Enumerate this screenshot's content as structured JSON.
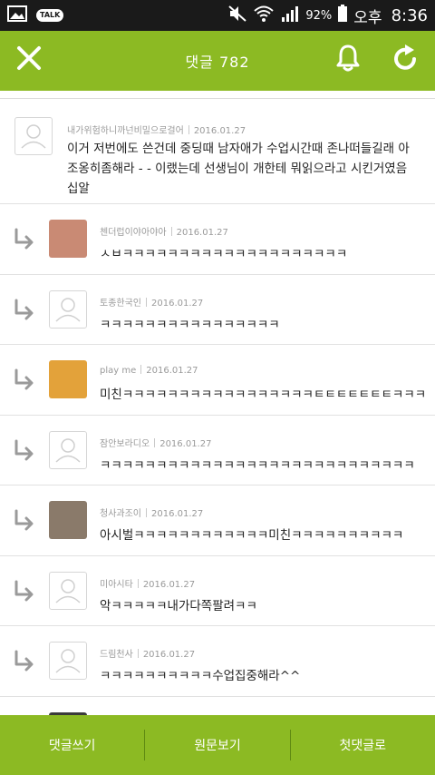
{
  "status_bar": {
    "battery_percent": "92%",
    "ampm": "오후",
    "time": "8:36",
    "talk_badge": "TALK"
  },
  "header": {
    "title": "댓글 782",
    "icons": [
      "close-icon",
      "bell-icon",
      "refresh-icon"
    ]
  },
  "comments": [
    {
      "author": "내가위험하니까넌비밀으로걸어",
      "date": "2016.01.27",
      "text": "이거 저번에도 쓴건데 중딩때 남자애가 수업시간때 존나떠들길래 아조옹히좀해라 - - 이랬는데 선생님이 개한테 뭐읽으라고 시킨거였음 십알"
    }
  ],
  "replies": [
    {
      "author": "첸더럽이야아야아",
      "date": "2016.01.27",
      "text": "ㅅㅂㅋㅋㅋㅋㅋㅋㅋㅋㅋㅋㅋㅋㅋㅋㅋㅋㅋㅋㅋㅋ",
      "avatar": "photo",
      "avatar_color": "#c98a74"
    },
    {
      "author": "토종한국인",
      "date": "2016.01.27",
      "text": "ㅋㅋㅋㅋㅋㅋㅋㅋㅋㅋㅋㅋㅋㅋㅋㅋ",
      "avatar": "default",
      "avatar_color": "#ffffff"
    },
    {
      "author": "play me",
      "date": "2016.01.27",
      "text": "미친ㅋㅋㅋㅋㅋㅋㅋㅋㅋㅋㅋㅋㅋㅋㅋㅋㅋㅌㅌㅌㅌㅌㅌㅌㅋㅋㅋㅋ",
      "avatar": "photo",
      "avatar_color": "#e3a23a"
    },
    {
      "author": "잠안보라디오",
      "date": "2016.01.27",
      "text": "ㅋㅋㅋㅋㅋㅋㅋㅋㅋㅋㅋㅋㅋㅋㅋㅋㅋㅋㅋㅋㅋㅋㅋㅋㅋㅋㅋㅋ",
      "avatar": "default",
      "avatar_color": "#ffffff"
    },
    {
      "author": "청사과조이",
      "date": "2016.01.27",
      "text": "아시벌ㅋㅋㅋㅋㅋㅋㅋㅋㅋㅋㅋㅋ미친ㅋㅋㅋㅋㅋㅋㅋㅋㅋㅋ",
      "avatar": "photo",
      "avatar_color": "#8a7a6a"
    },
    {
      "author": "미아시타",
      "date": "2016.01.27",
      "text": "악ㅋㅋㅋㅋㅋ내가다쪽팔려ㅋㅋ",
      "avatar": "default",
      "avatar_color": "#ffffff"
    },
    {
      "author": "드림천사",
      "date": "2016.01.27",
      "text": "ㅋㅋㅋㅋㅋㅋㅋㅋㅋㅋ수업집중해라^^",
      "avatar": "default",
      "avatar_color": "#ffffff"
    },
    {
      "author": "",
      "date": "",
      "text": "",
      "avatar": "photo",
      "avatar_color": "#3a3a3a"
    }
  ],
  "bottom_bar": {
    "write_comment": "댓글쓰기",
    "view_original": "원문보기",
    "first_comment": "첫댓글로"
  },
  "colors": {
    "accent_green": "#8cba23",
    "status_bar_bg": "#1a1a1a"
  }
}
